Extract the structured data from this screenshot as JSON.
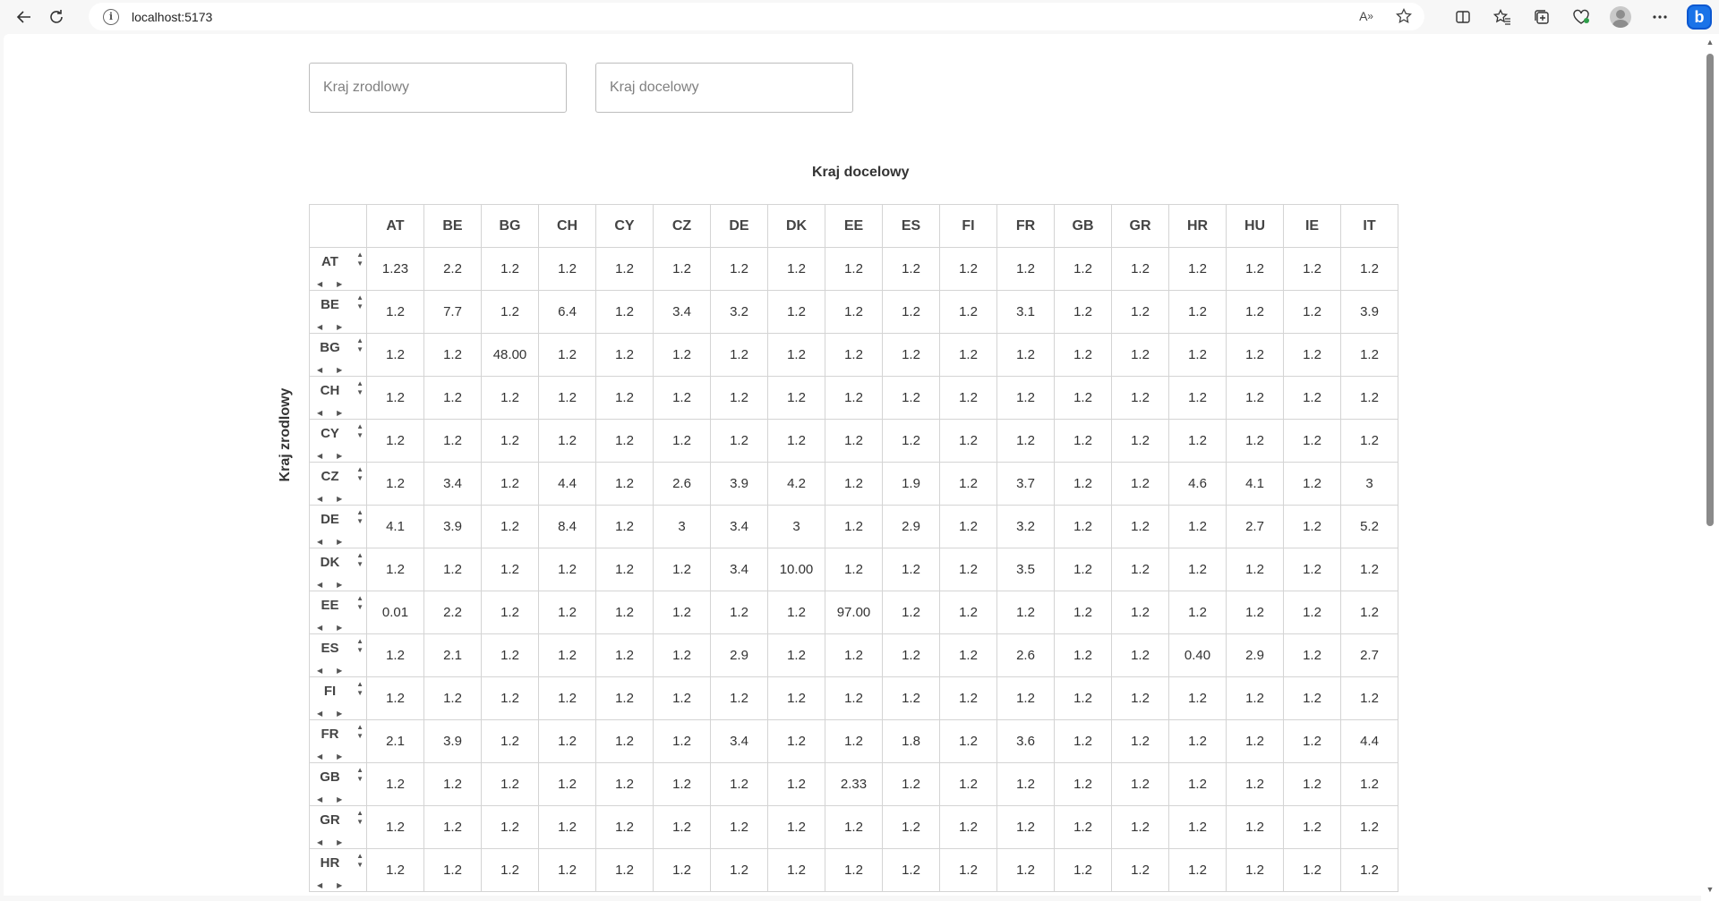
{
  "browser": {
    "url": "localhost:5173",
    "icons": [
      "back-icon",
      "reload-icon",
      "site-info-icon",
      "read-aloud-icon",
      "favorite-star-icon",
      "split-screen-icon",
      "favorites-icon",
      "collections-icon",
      "browser-essentials-icon",
      "profile-avatar-icon",
      "more-icon",
      "copilot-icon"
    ]
  },
  "filters": {
    "source_placeholder": "Kraj zrodlowy",
    "target_placeholder": "Kraj docelowy"
  },
  "matrix": {
    "column_axis_label": "Kraj docelowy",
    "row_axis_label": "Kraj zrodlowy",
    "columns": [
      "AT",
      "BE",
      "BG",
      "CH",
      "CY",
      "CZ",
      "DE",
      "DK",
      "EE",
      "ES",
      "FI",
      "FR",
      "GB",
      "GR",
      "HR",
      "HU",
      "IE",
      "IT"
    ],
    "rows": [
      {
        "label": "AT",
        "values": [
          "1.23",
          "2.2",
          "1.2",
          "1.2",
          "1.2",
          "1.2",
          "1.2",
          "1.2",
          "1.2",
          "1.2",
          "1.2",
          "1.2",
          "1.2",
          "1.2",
          "1.2",
          "1.2",
          "1.2",
          "1.2"
        ]
      },
      {
        "label": "BE",
        "values": [
          "1.2",
          "7.7",
          "1.2",
          "6.4",
          "1.2",
          "3.4",
          "3.2",
          "1.2",
          "1.2",
          "1.2",
          "1.2",
          "3.1",
          "1.2",
          "1.2",
          "1.2",
          "1.2",
          "1.2",
          "3.9"
        ]
      },
      {
        "label": "BG",
        "values": [
          "1.2",
          "1.2",
          "48.00",
          "1.2",
          "1.2",
          "1.2",
          "1.2",
          "1.2",
          "1.2",
          "1.2",
          "1.2",
          "1.2",
          "1.2",
          "1.2",
          "1.2",
          "1.2",
          "1.2",
          "1.2"
        ]
      },
      {
        "label": "CH",
        "values": [
          "1.2",
          "1.2",
          "1.2",
          "1.2",
          "1.2",
          "1.2",
          "1.2",
          "1.2",
          "1.2",
          "1.2",
          "1.2",
          "1.2",
          "1.2",
          "1.2",
          "1.2",
          "1.2",
          "1.2",
          "1.2"
        ]
      },
      {
        "label": "CY",
        "values": [
          "1.2",
          "1.2",
          "1.2",
          "1.2",
          "1.2",
          "1.2",
          "1.2",
          "1.2",
          "1.2",
          "1.2",
          "1.2",
          "1.2",
          "1.2",
          "1.2",
          "1.2",
          "1.2",
          "1.2",
          "1.2"
        ]
      },
      {
        "label": "CZ",
        "values": [
          "1.2",
          "3.4",
          "1.2",
          "4.4",
          "1.2",
          "2.6",
          "3.9",
          "4.2",
          "1.2",
          "1.9",
          "1.2",
          "3.7",
          "1.2",
          "1.2",
          "4.6",
          "4.1",
          "1.2",
          "3"
        ]
      },
      {
        "label": "DE",
        "values": [
          "4.1",
          "3.9",
          "1.2",
          "8.4",
          "1.2",
          "3",
          "3.4",
          "3",
          "1.2",
          "2.9",
          "1.2",
          "3.2",
          "1.2",
          "1.2",
          "1.2",
          "2.7",
          "1.2",
          "5.2"
        ]
      },
      {
        "label": "DK",
        "values": [
          "1.2",
          "1.2",
          "1.2",
          "1.2",
          "1.2",
          "1.2",
          "3.4",
          "10.00",
          "1.2",
          "1.2",
          "1.2",
          "3.5",
          "1.2",
          "1.2",
          "1.2",
          "1.2",
          "1.2",
          "1.2"
        ]
      },
      {
        "label": "EE",
        "values": [
          "0.01",
          "2.2",
          "1.2",
          "1.2",
          "1.2",
          "1.2",
          "1.2",
          "1.2",
          "97.00",
          "1.2",
          "1.2",
          "1.2",
          "1.2",
          "1.2",
          "1.2",
          "1.2",
          "1.2",
          "1.2"
        ]
      },
      {
        "label": "ES",
        "values": [
          "1.2",
          "2.1",
          "1.2",
          "1.2",
          "1.2",
          "1.2",
          "2.9",
          "1.2",
          "1.2",
          "1.2",
          "1.2",
          "2.6",
          "1.2",
          "1.2",
          "0.40",
          "2.9",
          "1.2",
          "2.7"
        ]
      },
      {
        "label": "FI",
        "values": [
          "1.2",
          "1.2",
          "1.2",
          "1.2",
          "1.2",
          "1.2",
          "1.2",
          "1.2",
          "1.2",
          "1.2",
          "1.2",
          "1.2",
          "1.2",
          "1.2",
          "1.2",
          "1.2",
          "1.2",
          "1.2"
        ]
      },
      {
        "label": "FR",
        "values": [
          "2.1",
          "3.9",
          "1.2",
          "1.2",
          "1.2",
          "1.2",
          "3.4",
          "1.2",
          "1.2",
          "1.8",
          "1.2",
          "3.6",
          "1.2",
          "1.2",
          "1.2",
          "1.2",
          "1.2",
          "4.4"
        ]
      },
      {
        "label": "GB",
        "values": [
          "1.2",
          "1.2",
          "1.2",
          "1.2",
          "1.2",
          "1.2",
          "1.2",
          "1.2",
          "2.33",
          "1.2",
          "1.2",
          "1.2",
          "1.2",
          "1.2",
          "1.2",
          "1.2",
          "1.2",
          "1.2"
        ]
      },
      {
        "label": "GR",
        "values": [
          "1.2",
          "1.2",
          "1.2",
          "1.2",
          "1.2",
          "1.2",
          "1.2",
          "1.2",
          "1.2",
          "1.2",
          "1.2",
          "1.2",
          "1.2",
          "1.2",
          "1.2",
          "1.2",
          "1.2",
          "1.2"
        ]
      },
      {
        "label": "HR",
        "values": [
          "1.2",
          "1.2",
          "1.2",
          "1.2",
          "1.2",
          "1.2",
          "1.2",
          "1.2",
          "1.2",
          "1.2",
          "1.2",
          "1.2",
          "1.2",
          "1.2",
          "1.2",
          "1.2",
          "1.2",
          "1.2"
        ]
      }
    ]
  }
}
